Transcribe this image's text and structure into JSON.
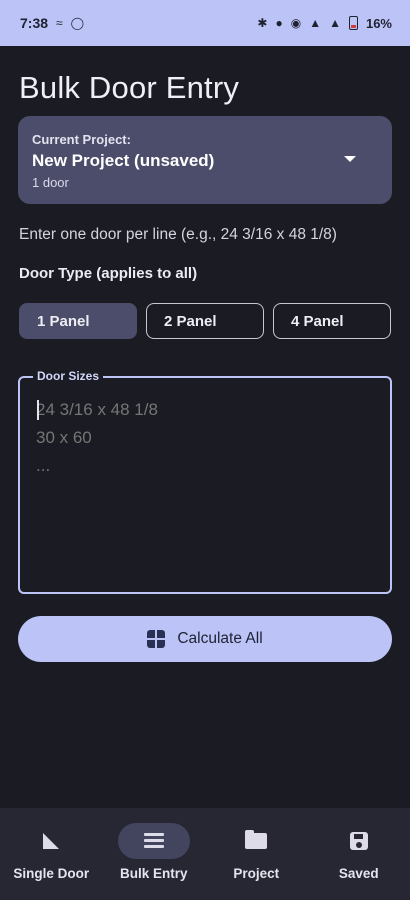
{
  "status_bar": {
    "time": "7:38",
    "battery_percent": "16%",
    "battery_color": "#d23b3b"
  },
  "page": {
    "title": "Bulk Door Entry"
  },
  "project_card": {
    "label": "Current Project:",
    "name": "New Project (unsaved)",
    "door_count": "1 door"
  },
  "instructions": {
    "hint": "Enter one door per line (e.g., 24 3/16 x 48 1/8)",
    "door_type_label": "Door Type (applies to all)"
  },
  "door_type": {
    "options": [
      "1 Panel",
      "2 Panel",
      "4 Panel"
    ],
    "selected": "1 Panel"
  },
  "door_sizes": {
    "label": "Door Sizes",
    "placeholder": "24 3/16 x 48 1/8\n30 x 60\n...",
    "value": ""
  },
  "actions": {
    "calculate_label": "Calculate All"
  },
  "bottom_nav": {
    "items": [
      {
        "label": "Single Door",
        "icon": "triangle-ruler-icon"
      },
      {
        "label": "Bulk Entry",
        "icon": "list-icon"
      },
      {
        "label": "Project",
        "icon": "folder-icon"
      },
      {
        "label": "Saved",
        "icon": "save-icon"
      }
    ],
    "active": "Bulk Entry"
  },
  "colors": {
    "accent": "#bcc3f7",
    "background": "#1b1c23",
    "card": "#4b4d6a"
  }
}
